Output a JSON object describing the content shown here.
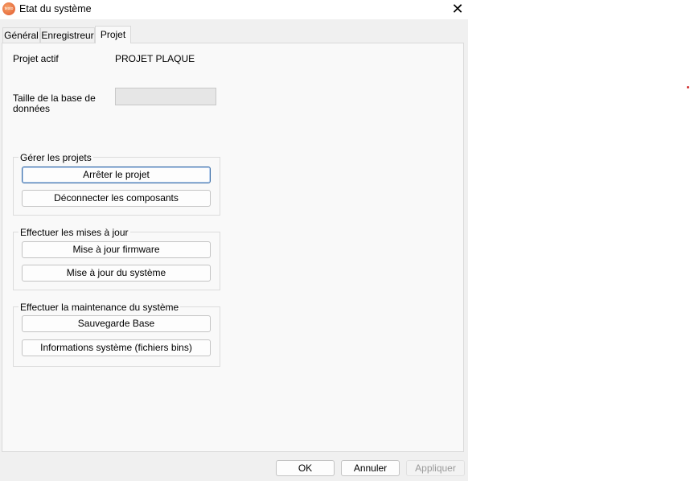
{
  "window": {
    "title": "Etat du système",
    "icon_label": "testo",
    "close_glyph": "✕"
  },
  "tabs": [
    {
      "label": "Général",
      "active": false
    },
    {
      "label": "Enregistreur",
      "active": false
    },
    {
      "label": "Projet",
      "active": true
    }
  ],
  "project": {
    "active_label": "Projet actif",
    "active_value": "PROJET PLAQUE",
    "db_size_label_line1": "Taille de la base de",
    "db_size_label_line2": "données",
    "db_size_value": ""
  },
  "groups": {
    "manage": {
      "legend": "Gérer les projets",
      "stop_project": "Arrêter le projet",
      "disconnect": "Déconnecter les composants"
    },
    "updates": {
      "legend": "Effectuer les mises à jour",
      "firmware": "Mise à jour firmware",
      "system": "Mise à jour du système"
    },
    "maintenance": {
      "legend": "Effectuer la maintenance du système",
      "backup": "Sauvegarde Base",
      "sysinfo": "Informations système (fichiers bins)"
    }
  },
  "footer": {
    "ok": "OK",
    "cancel": "Annuler",
    "apply": "Appliquer"
  },
  "colors": {
    "accent": "#3b6ea8",
    "marker": "#d23030"
  }
}
